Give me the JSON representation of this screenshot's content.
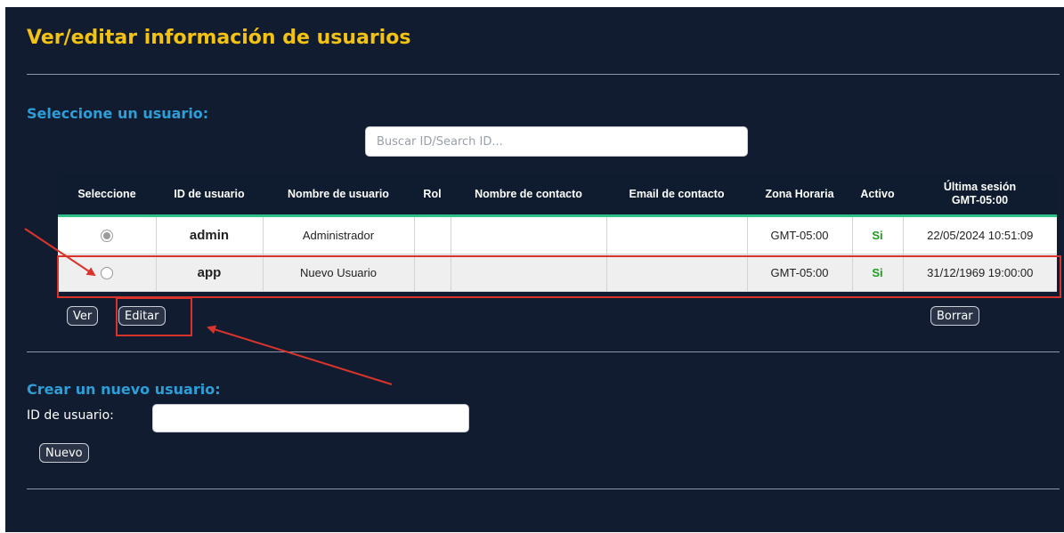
{
  "page": {
    "title": "Ver/editar información de usuarios",
    "select_section": "Seleccione un usuario:",
    "search_placeholder": "Buscar ID/Search ID...",
    "create_section": "Crear un nuevo usuario:",
    "user_id_label": "ID de usuario:"
  },
  "table": {
    "headers": [
      "Seleccione",
      "ID de usuario",
      "Nombre de usuario",
      "Rol",
      "Nombre de contacto",
      "Email de contacto",
      "Zona Horaria",
      "Activo"
    ],
    "last_header_line1": "Última sesión",
    "last_header_line2": "GMT-05:00",
    "rows": [
      {
        "selected": true,
        "user_id": "admin",
        "username": "Administrador",
        "role": "",
        "contact_name": "",
        "contact_email": "",
        "timezone": "GMT-05:00",
        "active": "Si",
        "last_session": "22/05/2024 10:51:09"
      },
      {
        "selected": false,
        "user_id": "app",
        "username": "Nuevo Usuario",
        "role": "",
        "contact_name": "",
        "contact_email": "",
        "timezone": "GMT-05:00",
        "active": "Si",
        "last_session": "31/12/1969 19:00:00"
      }
    ]
  },
  "buttons": {
    "view": "Ver",
    "edit": "Editar",
    "delete": "Borrar",
    "new": "Nuevo"
  },
  "colors": {
    "background": "#111c30",
    "title": "#f3c212",
    "section_title": "#2c9ed8",
    "header_underline": "#2fc087",
    "active_text": "#1f9c1f",
    "annotation": "#d8342c"
  }
}
